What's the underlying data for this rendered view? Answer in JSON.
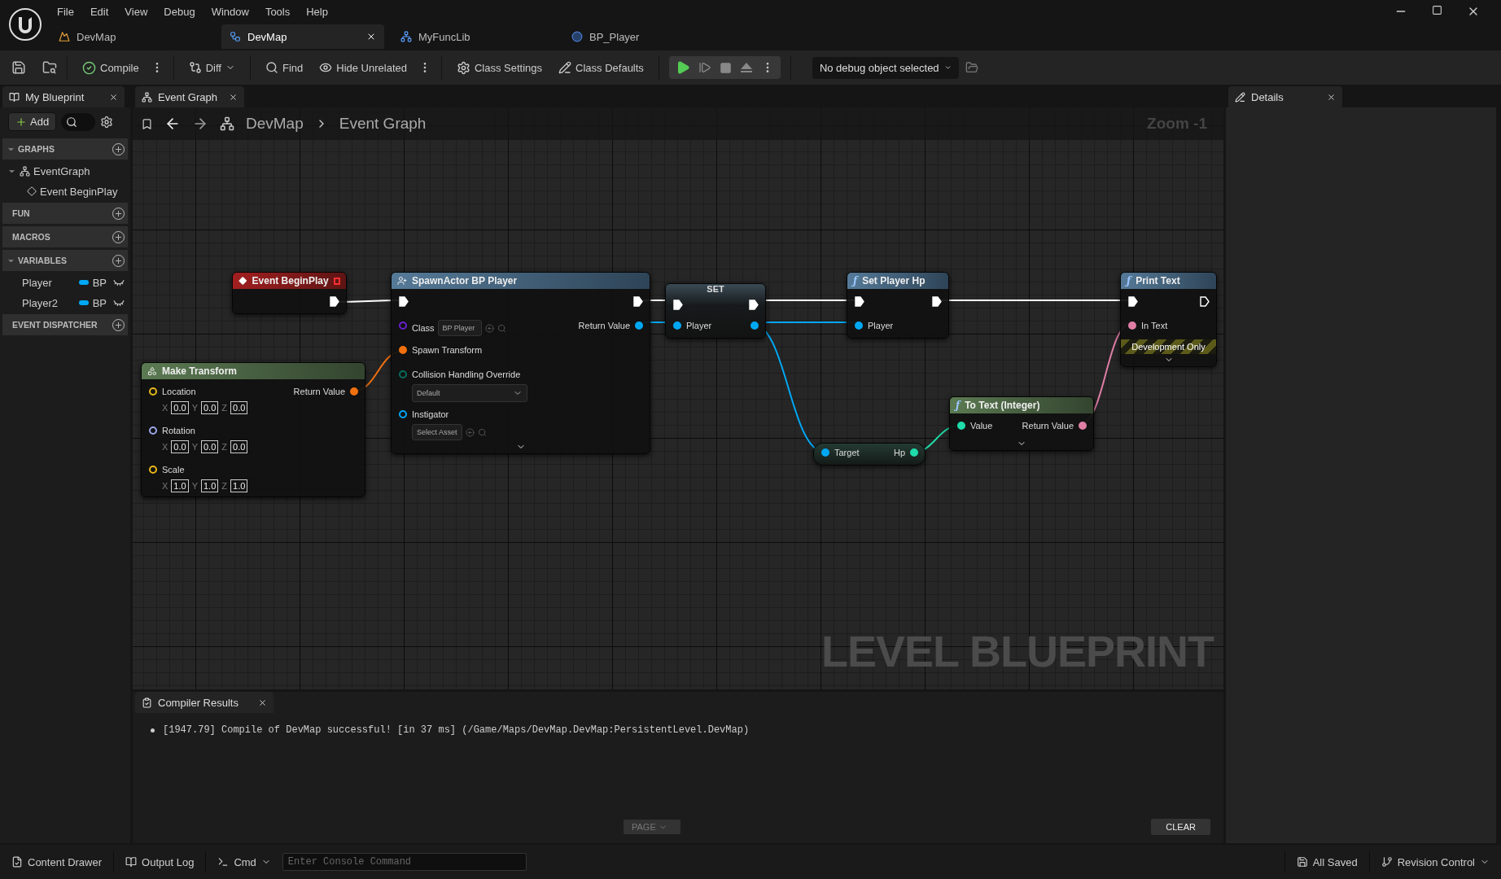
{
  "menu": [
    "File",
    "Edit",
    "View",
    "Debug",
    "Window",
    "Tools",
    "Help"
  ],
  "doc_tabs": [
    {
      "label": "DevMap",
      "kind": "level",
      "selected": false
    },
    {
      "label": "DevMap",
      "kind": "blueprint",
      "selected": true
    },
    {
      "label": "MyFuncLib",
      "kind": "library",
      "selected": false
    },
    {
      "label": "BP_Player",
      "kind": "actor",
      "selected": false
    }
  ],
  "toolbar": {
    "compile": "Compile",
    "diff": "Diff",
    "find": "Find",
    "hide_unrelated": "Hide Unrelated",
    "class_settings": "Class Settings",
    "class_defaults": "Class Defaults",
    "debug_object": "No debug object selected"
  },
  "my_blueprint": {
    "title": "My Blueprint",
    "add": "Add",
    "sections": [
      {
        "title": "GRAPHS",
        "expanded": true,
        "items": [
          {
            "label": "EventGraph",
            "kind": "graph",
            "expanded": true,
            "children": [
              {
                "label": "Event BeginPlay",
                "kind": "event"
              }
            ]
          }
        ]
      },
      {
        "title": "FUN",
        "expanded": false
      },
      {
        "title": "MACROS",
        "expanded": false
      },
      {
        "title": "VARIABLES",
        "expanded": true,
        "variables": [
          {
            "name": "Player",
            "type": "BP",
            "kind": "object"
          },
          {
            "name": "Player2",
            "type": "BP",
            "kind": "object"
          }
        ]
      },
      {
        "title": "EVENT DISPATCHER",
        "expanded": false
      }
    ]
  },
  "graph": {
    "tab": "Event Graph",
    "breadcrumb": [
      "DevMap",
      "Event Graph"
    ],
    "zoom": "Zoom -1",
    "graph_type_label": "LEVEL BLUEPRINT",
    "nodes": [
      {
        "kind": "event",
        "title": "Event BeginPlay",
        "delegate": true,
        "rows": [
          {
            "right": {
              "kind": "exec",
              "connected": true
            }
          }
        ]
      },
      {
        "kind": "spawn",
        "title": "SpawnActor BP Player",
        "advanced": true,
        "rows": [
          {
            "left": {
              "kind": "exec",
              "connected": true
            },
            "right": {
              "kind": "exec",
              "connected": true
            }
          },
          {
            "left": {
              "kind": "class",
              "label": "Class",
              "connected": false,
              "widget": {
                "kind": "inline-asset",
                "value": "BP Player"
              }
            },
            "right": {
              "kind": "object",
              "label": "Return Value",
              "connected": true
            }
          },
          {
            "left": {
              "kind": "struct",
              "label": "Spawn Transform",
              "connected": true
            }
          },
          {
            "left": {
              "kind": "enum",
              "label": "Collision Handling Override",
              "connected": false,
              "widget": {
                "kind": "combo",
                "value": "Default"
              }
            }
          },
          {
            "left": {
              "kind": "object",
              "label": "Instigator",
              "connected": false,
              "widget": {
                "kind": "asset",
                "value": "Select Asset"
              }
            }
          }
        ]
      },
      {
        "kind": "set",
        "title": "SET",
        "rows": [
          {
            "left": {
              "kind": "exec",
              "connected": true
            },
            "right": {
              "kind": "exec",
              "connected": true
            }
          },
          {
            "left": {
              "kind": "object",
              "label": "Player",
              "connected": true
            },
            "right": {
              "kind": "object",
              "connected": true
            }
          }
        ]
      },
      {
        "kind": "function",
        "icon": "ƒ",
        "title": "Set Player Hp",
        "rows": [
          {
            "left": {
              "kind": "exec",
              "connected": true
            },
            "right": {
              "kind": "exec",
              "connected": true
            }
          },
          {
            "left": {
              "kind": "object",
              "label": "Player",
              "connected": true
            }
          }
        ]
      },
      {
        "kind": "function",
        "icon": "ƒ",
        "title": "Print Text",
        "banner": "Development Only",
        "advanced": true,
        "rows": [
          {
            "left": {
              "kind": "exec",
              "connected": true
            },
            "right": {
              "kind": "exec",
              "connected": false
            }
          },
          {
            "left": {
              "kind": "text",
              "label": "In Text",
              "connected": true
            }
          }
        ]
      },
      {
        "kind": "make",
        "title": "Make Transform",
        "rows": [
          {
            "left": {
              "kind": "vector",
              "label": "Location",
              "connected": false,
              "fields": [
                {
                  "axis": "X",
                  "value": "0.0"
                },
                {
                  "axis": "Y",
                  "value": "0.0"
                },
                {
                  "axis": "Z",
                  "value": "0.0"
                }
              ]
            },
            "right": {
              "kind": "struct",
              "label": "Return Value",
              "connected": true
            }
          },
          {
            "left": {
              "kind": "rotator",
              "label": "Rotation",
              "connected": false,
              "fields": [
                {
                  "axis": "X",
                  "value": "0.0"
                },
                {
                  "axis": "Y",
                  "value": "0.0"
                },
                {
                  "axis": "Z",
                  "value": "0.0"
                }
              ]
            }
          },
          {
            "left": {
              "kind": "vector",
              "label": "Scale",
              "connected": false,
              "fields": [
                {
                  "axis": "X",
                  "value": "1.0"
                },
                {
                  "axis": "Y",
                  "value": "1.0"
                },
                {
                  "axis": "Z",
                  "value": "1.0"
                }
              ]
            }
          }
        ]
      },
      {
        "kind": "pure",
        "icon": "ƒ",
        "title": "To Text (Integer)",
        "advanced": true,
        "rows": [
          {
            "left": {
              "kind": "int",
              "label": "Value",
              "connected": true
            },
            "right": {
              "kind": "text",
              "label": "Return Value",
              "connected": true
            }
          }
        ]
      },
      {
        "kind": "getter",
        "rows": [
          {
            "left": {
              "kind": "object",
              "label": "Target",
              "connected": true
            },
            "right": {
              "kind": "int",
              "label": "Hp",
              "connected": true
            }
          }
        ]
      }
    ]
  },
  "compiler_results": {
    "title": "Compiler Results",
    "messages": [
      "[1947.79] Compile of DevMap successful! [in 37 ms] (/Game/Maps/DevMap.DevMap:PersistentLevel.DevMap)"
    ],
    "page": "PAGE",
    "clear": "CLEAR"
  },
  "details": {
    "title": "Details"
  },
  "status_bar": {
    "content_drawer": "Content Drawer",
    "output_log": "Output Log",
    "cmd": "Cmd",
    "console_placeholder": "Enter Console Command",
    "saved": "All Saved",
    "revision_control": "Revision Control"
  }
}
